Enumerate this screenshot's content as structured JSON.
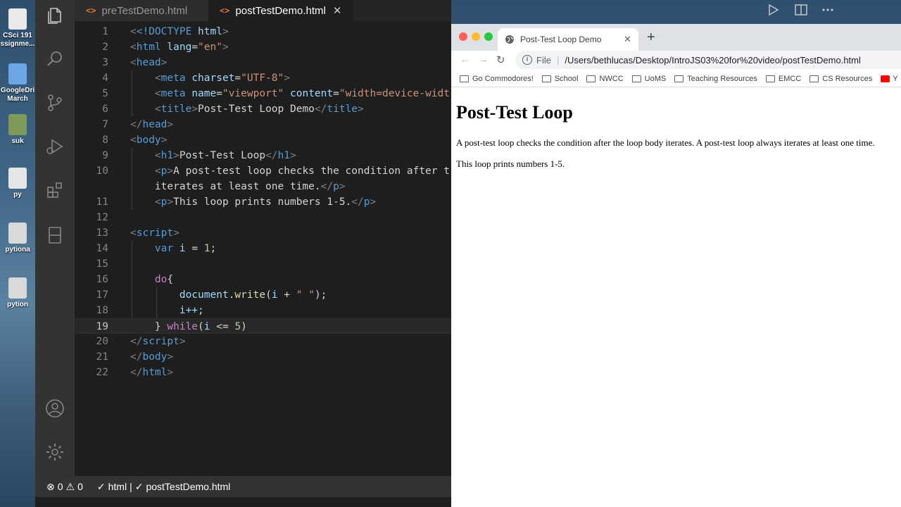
{
  "desktop": {
    "items": [
      {
        "label": "CSci 191",
        "label2": "ssignme..."
      },
      {
        "label": "GoogleDri",
        "label2": "March"
      },
      {
        "label": "suk"
      },
      {
        "label": "py"
      },
      {
        "label": "pytiona"
      },
      {
        "label": "pytion"
      }
    ]
  },
  "editor": {
    "tabs": [
      {
        "label": "preTestDemo.html",
        "icon": "html-icon"
      },
      {
        "label": "postTestDemo.html",
        "icon": "html-icon",
        "active": true
      }
    ],
    "lines": [
      {
        "n": "1"
      },
      {
        "n": "2"
      },
      {
        "n": "3"
      },
      {
        "n": "4"
      },
      {
        "n": "5"
      },
      {
        "n": "6"
      },
      {
        "n": "7"
      },
      {
        "n": "8"
      },
      {
        "n": "9"
      },
      {
        "n": "10"
      },
      {
        "n": ""
      },
      {
        "n": "11"
      },
      {
        "n": "12"
      },
      {
        "n": "13"
      },
      {
        "n": "14"
      },
      {
        "n": "15"
      },
      {
        "n": "16"
      },
      {
        "n": "17"
      },
      {
        "n": "18"
      },
      {
        "n": "19"
      },
      {
        "n": "20"
      },
      {
        "n": "21"
      },
      {
        "n": "22"
      }
    ],
    "tok": {
      "doctype": "<!DOCTYPE",
      "html_kw": "html",
      "gt": ">",
      "lt": "<",
      "lt_slash": "</",
      "html": "html",
      "lang": "lang",
      "eq": "=",
      "en": "\"en\"",
      "head": "head",
      "meta": "meta",
      "charset": "charset",
      "utf8": "\"UTF-8\"",
      "name": "name",
      "viewport": "\"viewport\"",
      "content": "content",
      "content_val": "\"width=device-widt",
      "title": "title",
      "title_text": "Post-Test Loop Demo",
      "body": "body",
      "h1": "h1",
      "h1_text": "Post-Test Loop",
      "p": "p",
      "p1_text_a": "A post-test loop checks the condition after t",
      "p1_text_b": "iterates at least one time.",
      "p2_text": "This loop prints numbers 1-5.",
      "script": "script",
      "var": "var",
      "i": "i",
      "eq_sp": " = ",
      "one": "1",
      "semi": ";",
      "do": "do",
      "brace_open": "{",
      "document": "document",
      "dot": ".",
      "write": "write",
      "paren_open": "(",
      "plus": " + ",
      "space_str": "\" \"",
      "paren_close_semi": ");",
      "ipp": "i++",
      "brace_close": "} ",
      "while": "while",
      "lte": " <= ",
      "five": "5",
      "paren_close": ")"
    }
  },
  "statusbar": {
    "errors": "0",
    "warnings": "0",
    "lang": "html",
    "sep": "|",
    "file": "postTestDemo.html"
  },
  "browser": {
    "tab_title": "Post-Test Loop Demo",
    "new_tab": "+",
    "omnibox_prefix": "File",
    "omnibox_sep": "|",
    "url": "/Users/bethlucas/Desktop/IntroJS03%20for%20video/postTestDemo.html",
    "bookmarks": [
      "Go Commodores!",
      "School",
      "NWCC",
      "UoMS",
      "Teaching Resources",
      "EMCC",
      "CS Resources"
    ],
    "bookmark_last": "Y",
    "page": {
      "heading": "Post-Test Loop",
      "para1": "A post-test loop checks the condition after the loop body iterates. A post-test loop always iterates at least one time.",
      "para2": "This loop prints numbers 1-5."
    }
  },
  "colors": {
    "editor_bg": "#1e1e1e",
    "activity_bg": "#333333",
    "status_bg": "#333333",
    "tag_color": "#569cd6",
    "attr_color": "#9cdcfe",
    "string_color": "#ce9178"
  }
}
